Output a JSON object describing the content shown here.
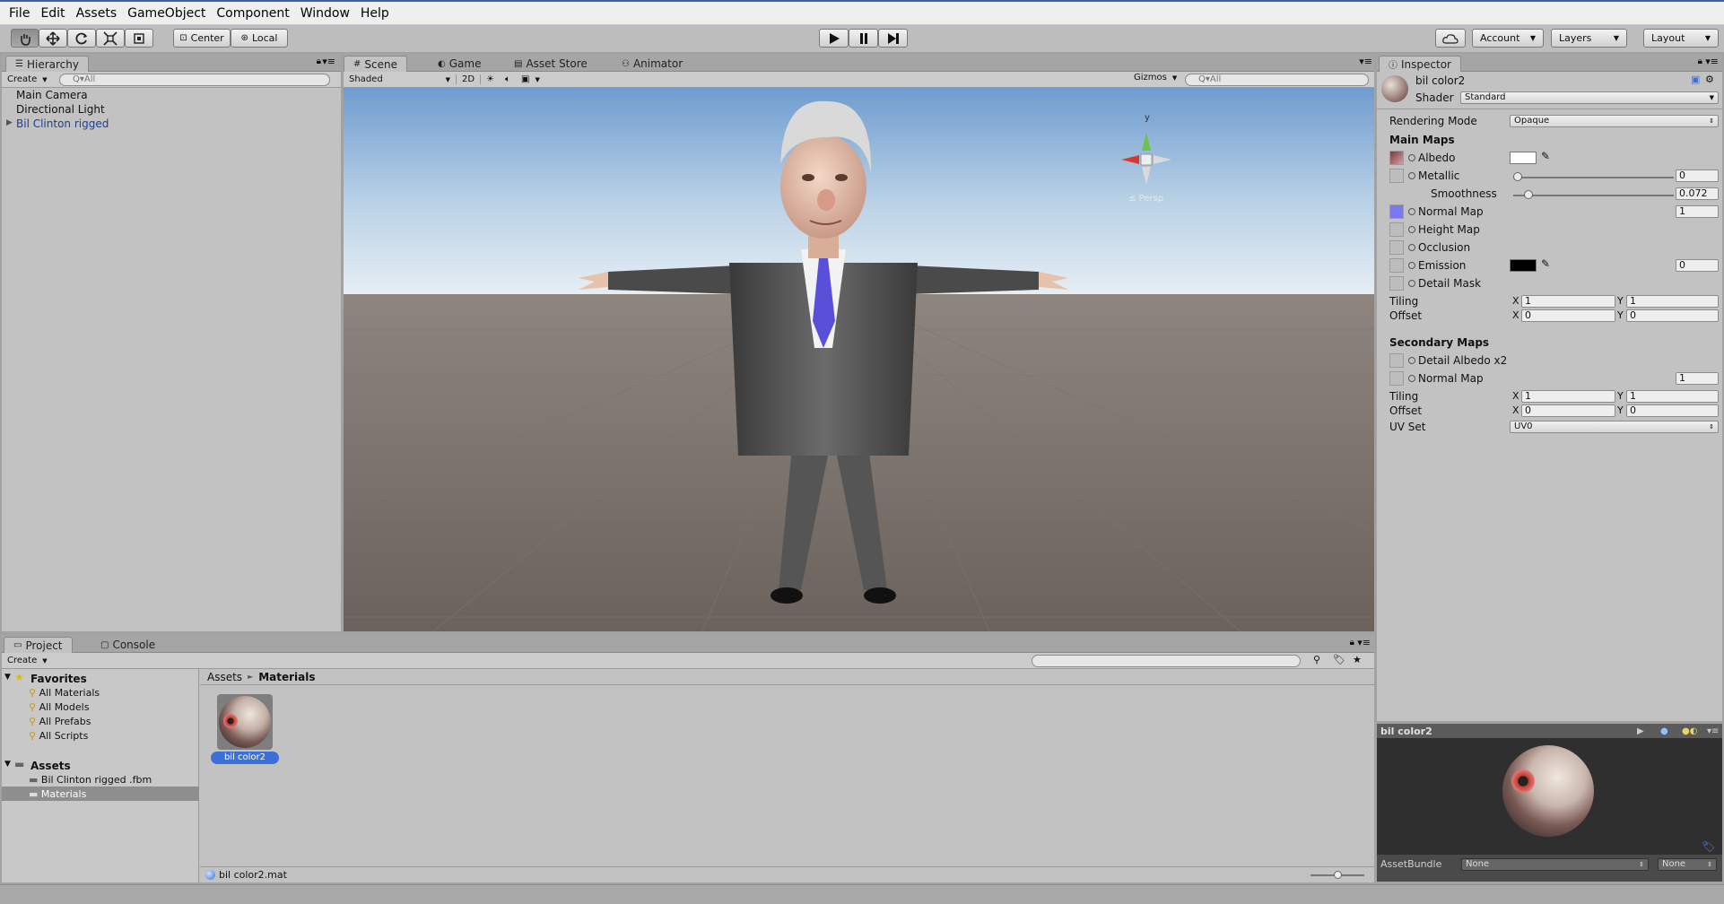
{
  "menu": [
    "File",
    "Edit",
    "Assets",
    "GameObject",
    "Component",
    "Window",
    "Help"
  ],
  "toolbar": {
    "tools": [
      "hand-icon",
      "move-icon",
      "rotate-icon",
      "scale-icon",
      "rect-icon"
    ],
    "pivot_label": "Center",
    "space_label": "Local",
    "account_label": "Account",
    "layers_label": "Layers",
    "layout_label": "Layout"
  },
  "hierarchy": {
    "tab": "Hierarchy",
    "create_label": "Create",
    "search_placeholder": "Q▾All",
    "items": [
      "Main Camera",
      "Directional Light",
      "Bil Clinton rigged"
    ]
  },
  "scene": {
    "tabs": [
      "Scene",
      "Game",
      "Asset Store",
      "Animator"
    ],
    "shading": "Shaded",
    "mode2d": "2D",
    "gizmos_label": "Gizmos",
    "search_placeholder": "Q▾All",
    "persp_label": "≤ Persp",
    "gizmo_y": "y"
  },
  "inspector": {
    "tab": "Inspector",
    "material_name": "bil color2",
    "shader_label": "Shader",
    "shader_value": "Standard",
    "rendering_mode_label": "Rendering Mode",
    "rendering_mode_value": "Opaque",
    "main_maps_title": "Main Maps",
    "albedo_label": "Albedo",
    "metallic_label": "Metallic",
    "metallic_value": "0",
    "metallic_level": 0,
    "smoothness_label": "Smoothness",
    "smoothness_value": "0.072",
    "smoothness_level": 0.072,
    "normal_map_label": "Normal Map",
    "normal_map_value": "1",
    "height_map_label": "Height Map",
    "occlusion_label": "Occlusion",
    "emission_label": "Emission",
    "emission_value": "0",
    "detail_mask_label": "Detail Mask",
    "tiling_label": "Tiling",
    "offset_label": "Offset",
    "x_label": "X",
    "y_label": "Y",
    "tiling_x": "1",
    "tiling_y": "1",
    "offset_x": "0",
    "offset_y": "0",
    "secondary_maps_title": "Secondary Maps",
    "detail_albedo_label": "Detail Albedo x2",
    "sec_normal_map_label": "Normal Map",
    "sec_normal_map_value": "1",
    "sec_tiling_x": "1",
    "sec_tiling_y": "1",
    "sec_offset_x": "0",
    "sec_offset_y": "0",
    "uv_set_label": "UV Set",
    "uv_set_value": "UV0",
    "preview_title": "bil color2",
    "assetbundle_label": "AssetBundle",
    "assetbundle_value": "None",
    "assetbundle_variant": "None"
  },
  "project": {
    "tabs": [
      "Project",
      "Console"
    ],
    "create_label": "Create",
    "favorites_label": "Favorites",
    "favorites": [
      "All Materials",
      "All Models",
      "All Prefabs",
      "All Scripts"
    ],
    "assets_label": "Assets",
    "assets": [
      "Bil Clinton rigged .fbm",
      "Materials"
    ],
    "breadcrumb_root": "Assets",
    "breadcrumb_sep": "►",
    "breadcrumb_current": "Materials",
    "asset_item": "bil color2",
    "status_file": "bil color2.mat"
  },
  "colors": {
    "accent_selection": "#3d6fd8",
    "selected_text": "#1a3fa0",
    "normal_map_swatch": "#7b79f2",
    "emission_swatch": "#000000",
    "albedo_swatch": "#ffffff"
  }
}
